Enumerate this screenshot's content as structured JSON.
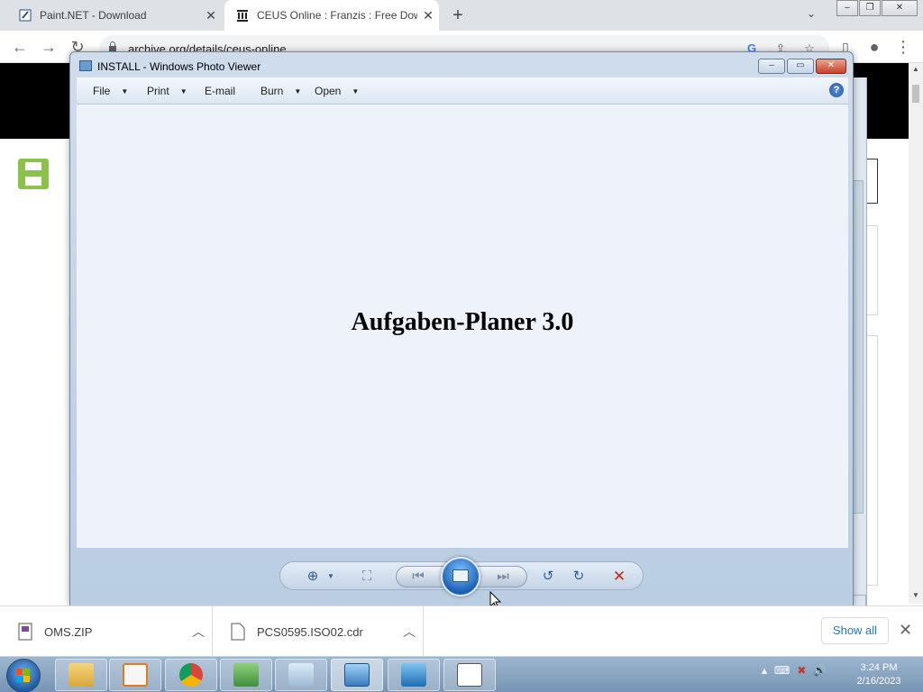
{
  "browser": {
    "tabs": [
      {
        "title": "Paint.NET - Download",
        "icon": "paintnet-icon"
      },
      {
        "title": "CEUS Online : Franzis : Free Dow",
        "icon": "archive-org-icon"
      }
    ],
    "url": "archive.org/details/ceus-online"
  },
  "photo_viewer": {
    "window_title": "INSTALL - Windows Photo Viewer",
    "menu": [
      "File",
      "Print",
      "E-mail",
      "Burn",
      "Open"
    ],
    "image_text": "Aufgaben-Planer 3.0",
    "help_label": "?"
  },
  "downloads": {
    "items": [
      "OMS.ZIP",
      "PCS0595.ISO02.cdr"
    ],
    "show_all": "Show all"
  },
  "taskbar": {
    "time": "3:24 PM",
    "date": "2/16/2023",
    "apps": [
      "explorer",
      "media-player",
      "chrome",
      "network",
      "notepad",
      "photo-viewer",
      "remote",
      "list"
    ]
  }
}
